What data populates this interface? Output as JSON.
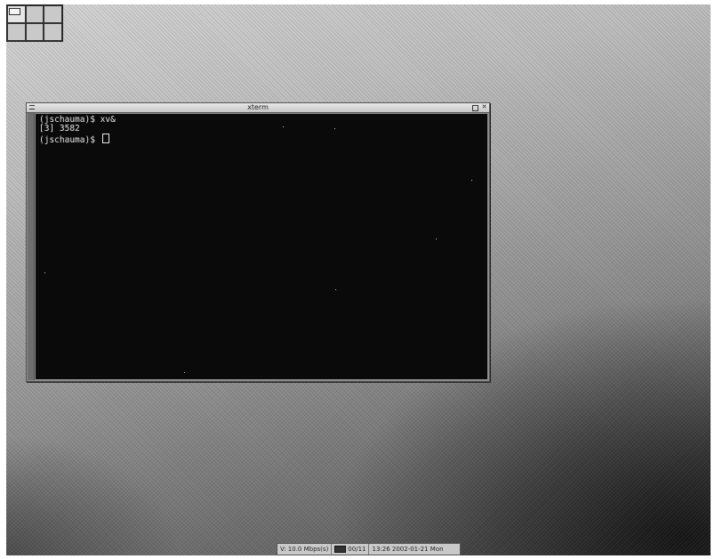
{
  "pager": {
    "desks": [
      {
        "id": "desk-1",
        "active": true
      },
      {
        "id": "desk-2",
        "active": false
      },
      {
        "id": "desk-3",
        "active": false
      },
      {
        "id": "desk-4",
        "active": false
      },
      {
        "id": "desk-5",
        "active": false
      },
      {
        "id": "desk-6",
        "active": false
      }
    ]
  },
  "xterm": {
    "title": "xterm",
    "buttons": {
      "menu_icon": "menu-icon",
      "maximize_icon": "maximize-icon",
      "close_glyph": "✕"
    },
    "lines": [
      "(jschauma)$ xv&",
      "[3] 3582",
      "(jschauma)$ "
    ]
  },
  "statusbar": {
    "memory": "V: 10.0 Mbps(s)",
    "mail_icon": "mail-icon",
    "mail_count": "00/11",
    "clock": "13:26 2002-01-21 Mon"
  },
  "colors": {
    "terminal_bg": "#0a0a0a",
    "terminal_fg": "#e6e6e6",
    "titlebar": "#d0d0d0"
  }
}
